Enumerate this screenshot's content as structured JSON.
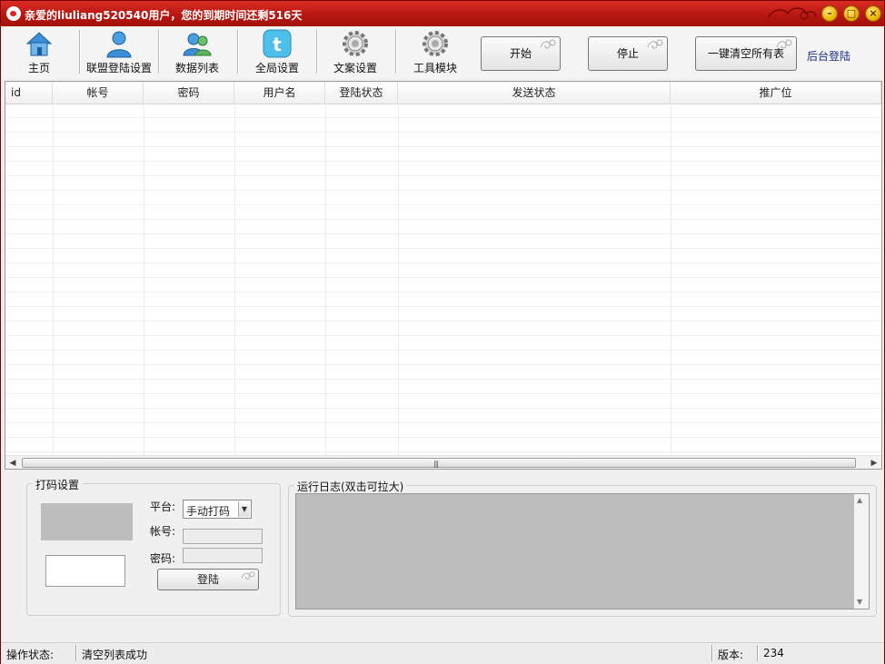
{
  "window": {
    "title": "亲爱的liuliang520540用户，您的到期时间还剩516天",
    "controls": [
      "minimize",
      "maximize",
      "close"
    ]
  },
  "toolbar": {
    "items": [
      {
        "label": "主页",
        "icon": "home-icon"
      },
      {
        "label": "联盟登陆设置",
        "icon": "user-icon"
      },
      {
        "label": "数据列表",
        "icon": "users-icon"
      },
      {
        "label": "全局设置",
        "icon": "twitter-bird-icon"
      },
      {
        "label": "文案设置",
        "icon": "gear-icon"
      },
      {
        "label": "工具模块",
        "icon": "gear-icon"
      }
    ],
    "start_label": "开始",
    "stop_label": "停止",
    "clear_label": "一键清空所有表",
    "backend_login_label": "后台登陆"
  },
  "grid": {
    "columns": [
      "id",
      "帐号",
      "密码",
      "用户名",
      "登陆状态",
      "发送状态",
      "推广位"
    ],
    "rows": []
  },
  "captcha_panel": {
    "title": "打码设置",
    "platform_label": "平台:",
    "platform_value": "手动打码",
    "account_label": "帐号:",
    "password_label": "密码:",
    "login_label": "登陆"
  },
  "log_panel": {
    "title": "运行日志(双击可拉大)"
  },
  "statusbar": {
    "op_label": "操作状态:",
    "op_value": "清空列表成功",
    "version_label": "版本:",
    "version_value": "234"
  },
  "colors": {
    "titlebar": "#b51610",
    "accent_link": "#1a2f8a",
    "captcha_box": "#bdbdbd"
  }
}
